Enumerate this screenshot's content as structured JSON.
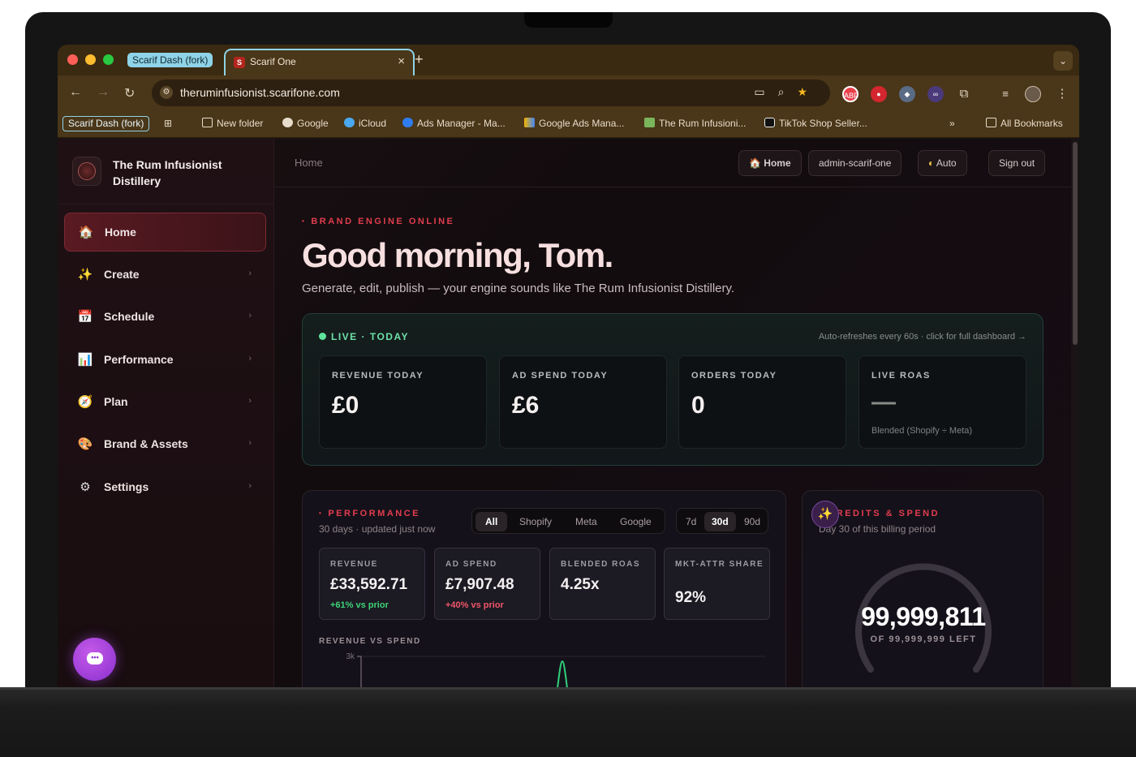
{
  "browser": {
    "tab_group": "Scarif Dash (fork)",
    "active_tab": {
      "favicon": "S",
      "title": "Scarif One"
    },
    "url": "theruminfusionist.scarifone.com",
    "bookmark_group": "Scarif Dash (fork)",
    "bookmarks": [
      {
        "label": "New folder",
        "icon": "folder-icon"
      },
      {
        "label": "Google",
        "icon": "google-icon"
      },
      {
        "label": "iCloud",
        "icon": "icloud-icon"
      },
      {
        "label": "Ads Manager - Ma...",
        "icon": "meta-icon"
      },
      {
        "label": "Google Ads Mana...",
        "icon": "google-ads-icon"
      },
      {
        "label": "The Rum Infusioni...",
        "icon": "shopify-icon"
      },
      {
        "label": "TikTok Shop Seller...",
        "icon": "tiktok-icon"
      }
    ],
    "all_bookmarks": "All Bookmarks",
    "extensions": [
      "abp-icon",
      "extension-icon",
      "shield-icon",
      "extension-icon",
      "puzzle-icon"
    ]
  },
  "sidebar": {
    "brand_name": "The Rum Infusionist Distillery",
    "items": [
      {
        "label": "Home",
        "icon": "🏠",
        "active": true
      },
      {
        "label": "Create",
        "icon": "✨"
      },
      {
        "label": "Schedule",
        "icon": "📅"
      },
      {
        "label": "Performance",
        "icon": "📊"
      },
      {
        "label": "Plan",
        "icon": "🧭"
      },
      {
        "label": "Brand & Assets",
        "icon": "🎨"
      },
      {
        "label": "Settings",
        "icon": "⚙"
      }
    ]
  },
  "topbar": {
    "breadcrumb": "Home",
    "home_button": "Home",
    "user_button": "admin-scarif-one",
    "theme_button": "Auto",
    "signout_button": "Sign out"
  },
  "hero": {
    "eyebrow": "BRAND ENGINE ONLINE",
    "title": "Good morning, Tom.",
    "subtitle": "Generate, edit, publish — your engine sounds like The Rum Infusionist Distillery."
  },
  "live": {
    "tag": "LIVE · TODAY",
    "note": "Auto-refreshes every 60s · click for full dashboard →",
    "kpis": [
      {
        "label": "REVENUE TODAY",
        "value": "£0"
      },
      {
        "label": "AD SPEND TODAY",
        "value": "£6"
      },
      {
        "label": "ORDERS TODAY",
        "value": "0"
      },
      {
        "label": "LIVE ROAS",
        "value": "—",
        "note": "Blended (Shopify ÷ Meta)"
      }
    ]
  },
  "performance": {
    "eyebrow": "PERFORMANCE",
    "subtitle": "30 days · updated just now",
    "channels": [
      "All",
      "Shopify",
      "Meta",
      "Google"
    ],
    "active_channel": "All",
    "ranges": [
      "7d",
      "30d",
      "90d"
    ],
    "active_range": "30d",
    "metrics": [
      {
        "label": "REVENUE",
        "value": "£33,592.71",
        "delta": "+61% vs prior",
        "delta_color": "#3fd27a"
      },
      {
        "label": "AD SPEND",
        "value": "£7,907.48",
        "delta": "+40% vs prior",
        "delta_color": "#f0566a"
      },
      {
        "label": "BLENDED ROAS",
        "value": "4.25x"
      },
      {
        "label": "MKT-ATTR SHARE",
        "value": "92%"
      }
    ],
    "chart_label": "REVENUE VS SPEND",
    "chart_ytick": "3k"
  },
  "credits": {
    "eyebrow": "CREDITS & SPEND",
    "subtitle": "Day 30 of this billing period",
    "value": "99,999,811",
    "left_label": "OF 99,999,999 LEFT",
    "remaining_fraction": 0.999998
  }
}
